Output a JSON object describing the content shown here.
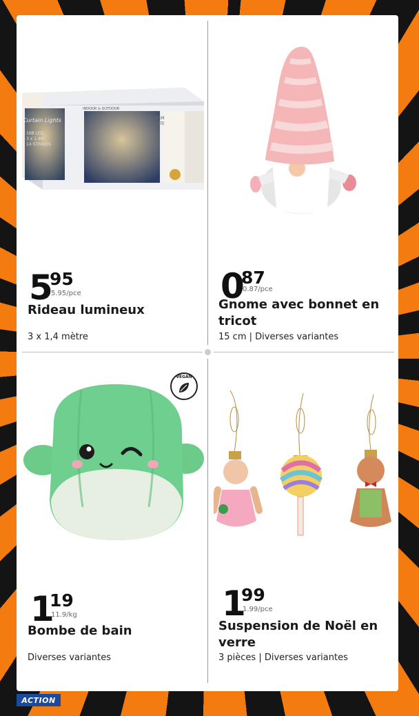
{
  "brand": {
    "logo_text": "ACTION"
  },
  "products": [
    {
      "price_int": "5",
      "price_dec": "95",
      "unit_price": "5.95/pce",
      "title": "Rideau lumineux",
      "subtitle": "3 x 1,4 mètre",
      "box_text": {
        "script": "Curtain Lights",
        "specs": "168 LED\n3 x 1,4M\n14 STRINGS",
        "top": "INDOOR & OUTDOOR",
        "color": "WARM\nWHITE"
      }
    },
    {
      "price_int": "0",
      "price_dec": "87",
      "unit_price": "0.87/pce",
      "title": "Gnome avec bonnet en tricot",
      "subtitle": "15 cm | Diverses variantes"
    },
    {
      "price_int": "1",
      "price_dec": "19",
      "unit_price": "11.9/kg",
      "title": "Bombe de bain",
      "subtitle": "Diverses variantes",
      "badge": "VEGAN"
    },
    {
      "price_int": "1",
      "price_dec": "99",
      "unit_price": "1.99/pce",
      "title": "Suspension de Noël en verre",
      "subtitle": "3 pièces | Diverses variantes"
    }
  ],
  "colors": {
    "orange": "#f47b10",
    "black": "#141414",
    "logo_blue": "#1a4a9b"
  }
}
